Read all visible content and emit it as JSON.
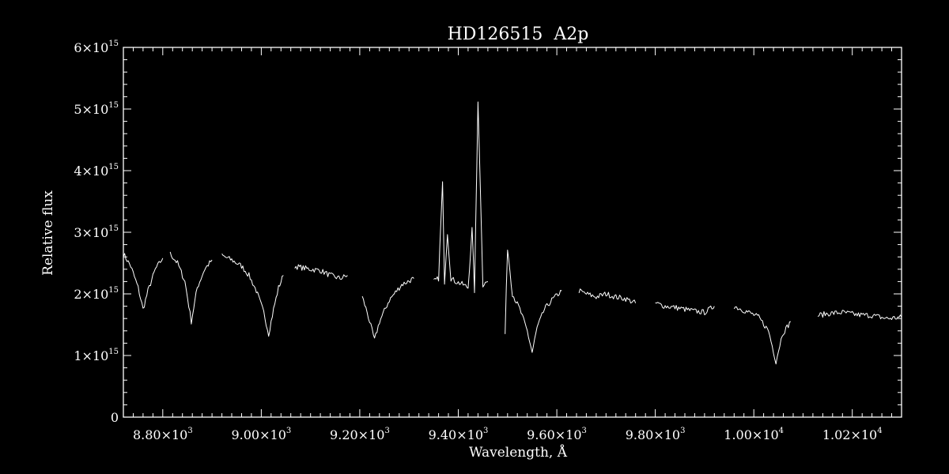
{
  "chart_data": {
    "type": "line",
    "title": "HD126515  A2p",
    "xlabel": "Wavelength, Å",
    "ylabel": "Relative flux",
    "xlim": [
      8720,
      10300
    ],
    "ylim": [
      0,
      6000000000000000.0
    ],
    "x_ticks": [
      {
        "value": 8800,
        "mantissa": "8.80",
        "exp": "3"
      },
      {
        "value": 9000,
        "mantissa": "9.00",
        "exp": "3"
      },
      {
        "value": 9200,
        "mantissa": "9.20",
        "exp": "3"
      },
      {
        "value": 9400,
        "mantissa": "9.40",
        "exp": "3"
      },
      {
        "value": 9600,
        "mantissa": "9.60",
        "exp": "3"
      },
      {
        "value": 9800,
        "mantissa": "9.80",
        "exp": "3"
      },
      {
        "value": 10000,
        "mantissa": "1.00",
        "exp": "4"
      },
      {
        "value": 10200,
        "mantissa": "1.02",
        "exp": "4"
      }
    ],
    "y_ticks": [
      {
        "value": 0,
        "mantissa": "0",
        "exp": ""
      },
      {
        "value": 1000000000000000.0,
        "mantissa": "1",
        "exp": "15"
      },
      {
        "value": 2000000000000000.0,
        "mantissa": "2",
        "exp": "15"
      },
      {
        "value": 3000000000000000.0,
        "mantissa": "3",
        "exp": "15"
      },
      {
        "value": 4000000000000000.0,
        "mantissa": "4",
        "exp": "15"
      },
      {
        "value": 5000000000000000.0,
        "mantissa": "5",
        "exp": "15"
      },
      {
        "value": 6000000000000000.0,
        "mantissa": "6",
        "exp": "15"
      }
    ],
    "color": "#ffffff",
    "background": "#000000",
    "series": [
      {
        "x": [
          8720,
          8735,
          8750,
          8760,
          8770,
          8785,
          8800
        ],
        "y": [
          2650000000000000.0,
          2450000000000000.0,
          2100000000000000.0,
          1750000000000000.0,
          2050000000000000.0,
          2400000000000000.0,
          2580000000000000.0
        ]
      },
      {
        "x": [
          8815,
          8830,
          8845,
          8858,
          8870,
          8885,
          8900
        ],
        "y": [
          2650000000000000.0,
          2500000000000000.0,
          2200000000000000.0,
          1550000000000000.0,
          2100000000000000.0,
          2400000000000000.0,
          2550000000000000.0
        ]
      },
      {
        "x": [
          8920,
          8940,
          8960,
          8975,
          8990,
          9005,
          9015,
          9025,
          9035,
          9045
        ],
        "y": [
          2620000000000000.0,
          2550000000000000.0,
          2450000000000000.0,
          2300000000000000.0,
          2050000000000000.0,
          1700000000000000.0,
          1350000000000000.0,
          1750000000000000.0,
          2100000000000000.0,
          2300000000000000.0
        ]
      },
      {
        "x": [
          9068,
          9085,
          9100,
          9120,
          9140,
          9160,
          9175
        ],
        "y": [
          2450000000000000.0,
          2420000000000000.0,
          2400000000000000.0,
          2380000000000000.0,
          2300000000000000.0,
          2250000000000000.0,
          2300000000000000.0
        ]
      },
      {
        "x": [
          9205,
          9215,
          9225,
          9230,
          9240,
          9260,
          9285,
          9310
        ],
        "y": [
          1950000000000000.0,
          1700000000000000.0,
          1400000000000000.0,
          1250000000000000.0,
          1550000000000000.0,
          1900000000000000.0,
          2150000000000000.0,
          2250000000000000.0
        ]
      },
      {
        "x": [
          9350,
          9360,
          9368,
          9372,
          9378,
          9385,
          9395,
          9410,
          9420,
          9428,
          9433,
          9440,
          9450,
          9460
        ],
        "y": [
          2200000000000000.0,
          2250000000000000.0,
          3800000000000000.0,
          2200000000000000.0,
          3000000000000000.0,
          2250000000000000.0,
          2200000000000000.0,
          2150000000000000.0,
          2100000000000000.0,
          3050000000000000.0,
          2050000000000000.0,
          5150000000000000.0,
          2150000000000000.0,
          2200000000000000.0
        ]
      },
      {
        "x": [
          9495,
          9500,
          9510,
          9525,
          9540,
          9550,
          9560,
          9575,
          9590,
          9610
        ],
        "y": [
          1350000000000000.0,
          2750000000000000.0,
          2000000000000000.0,
          1750000000000000.0,
          1400000000000000.0,
          1050000000000000.0,
          1450000000000000.0,
          1750000000000000.0,
          1900000000000000.0,
          2050000000000000.0
        ]
      },
      {
        "x": [
          9645,
          9660,
          9680,
          9700,
          9720,
          9740,
          9760
        ],
        "y": [
          2050000000000000.0,
          2000000000000000.0,
          1950000000000000.0,
          2000000000000000.0,
          1950000000000000.0,
          1920000000000000.0,
          1850000000000000.0
        ]
      },
      {
        "x": [
          9800,
          9820,
          9840,
          9860,
          9880,
          9900,
          9920
        ],
        "y": [
          1850000000000000.0,
          1800000000000000.0,
          1780000000000000.0,
          1750000000000000.0,
          1720000000000000.0,
          1700000000000000.0,
          1800000000000000.0
        ]
      },
      {
        "x": [
          9960,
          9975,
          9990,
          10010,
          10030,
          10045,
          10058,
          10075
        ],
        "y": [
          1800000000000000.0,
          1750000000000000.0,
          1700000000000000.0,
          1620000000000000.0,
          1400000000000000.0,
          900000000000000.0,
          1350000000000000.0,
          1550000000000000.0
        ]
      },
      {
        "x": [
          10130,
          10150,
          10180,
          10210,
          10240,
          10270,
          10300
        ],
        "y": [
          1650000000000000.0,
          1680000000000000.0,
          1700000000000000.0,
          1660000000000000.0,
          1650000000000000.0,
          1600000000000000.0,
          1620000000000000.0
        ]
      }
    ]
  }
}
